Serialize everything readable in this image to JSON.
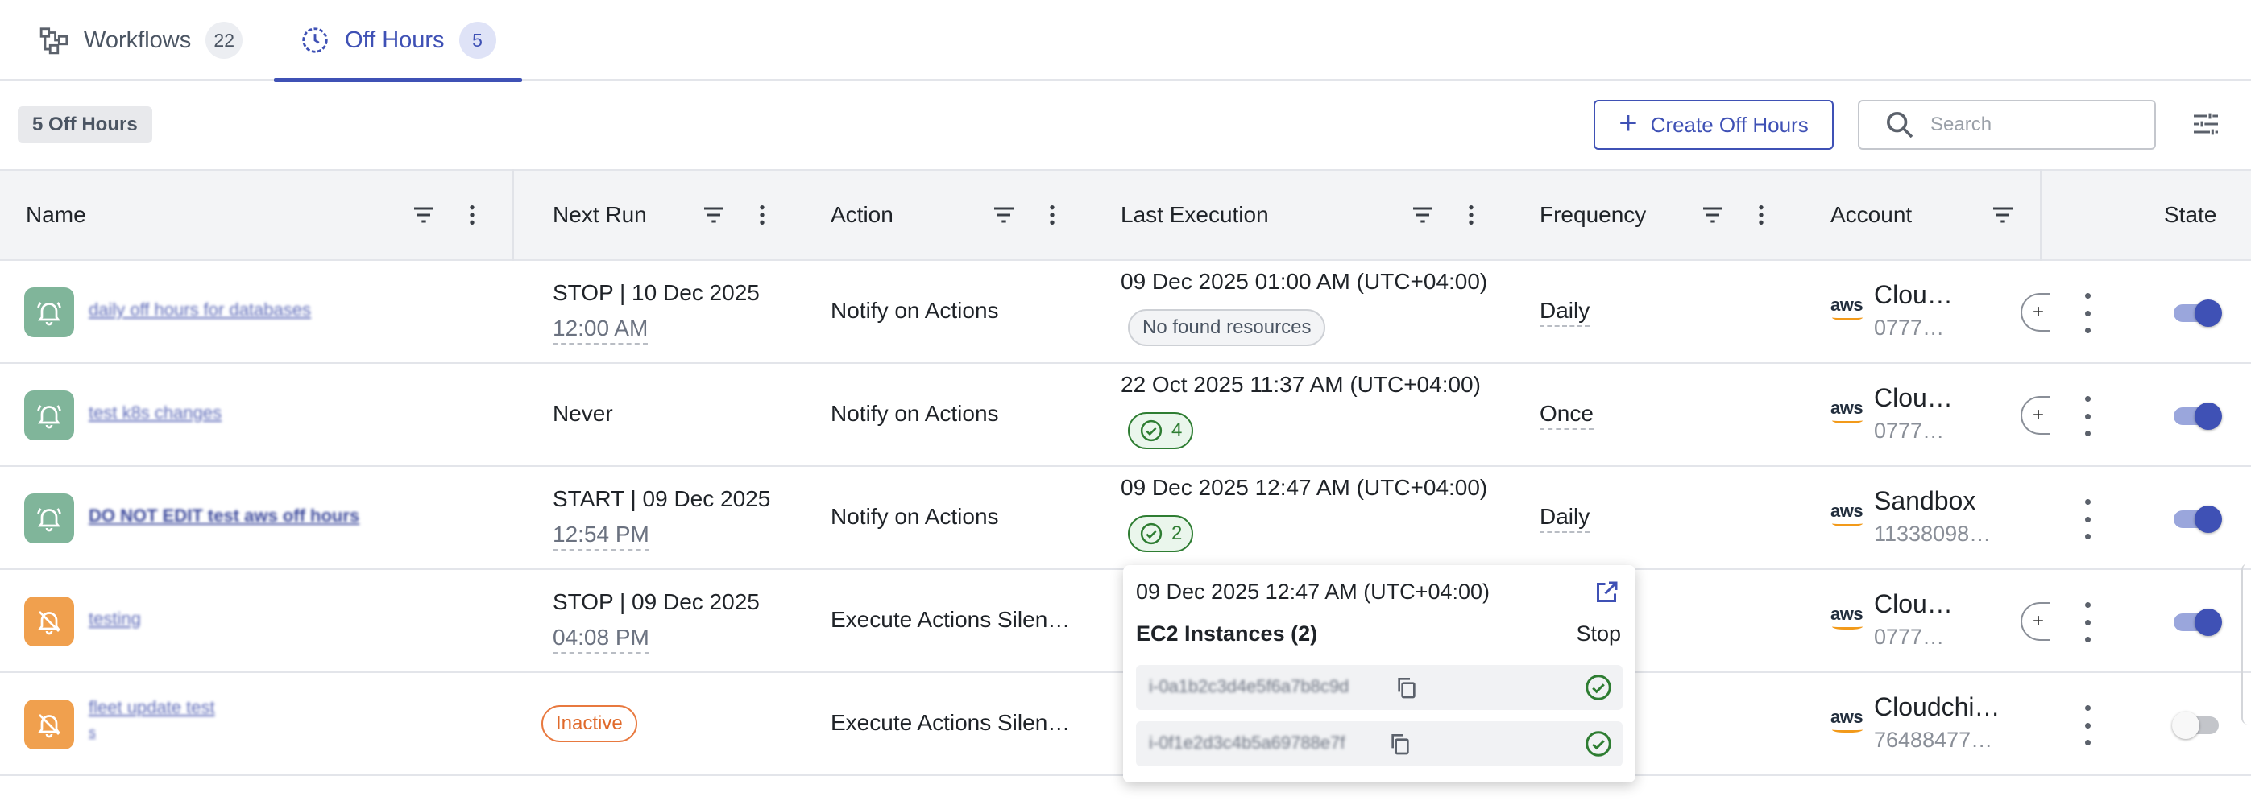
{
  "tabs": [
    {
      "label": "Workflows",
      "count": "22",
      "icon": "workflow-icon",
      "active": false
    },
    {
      "label": "Off Hours",
      "count": "5",
      "icon": "clock-icon",
      "active": true
    }
  ],
  "toolbar": {
    "count_label": "5 Off Hours",
    "create_label": "Create Off Hours",
    "search_placeholder": "Search"
  },
  "columns": {
    "name": "Name",
    "next_run": "Next Run",
    "action": "Action",
    "last_execution": "Last Execution",
    "frequency": "Frequency",
    "account": "Account",
    "state": "State"
  },
  "rows": [
    {
      "name": "daily off hours for databases",
      "name_sub": "",
      "avatar": "bell-icon",
      "next_run": "STOP | 10 Dec 2025",
      "next_run_time": "12:00 AM",
      "action": "Notify on Actions",
      "last_execution": "09 Dec 2025 01:00 AM (UTC+04:00)",
      "last_execution_chip": "No found resources",
      "frequency": "Daily",
      "account_name": "Clou…",
      "account_id": "0777…",
      "state": "on"
    },
    {
      "name": "test k8s changes",
      "name_sub": "",
      "avatar": "bell-icon",
      "next_run": "Never",
      "next_run_time": "",
      "action": "Notify on Actions",
      "last_execution": "22 Oct 2025 11:37 AM (UTC+04:00)",
      "last_execution_chip": "4",
      "frequency": "Once",
      "account_name": "Clou…",
      "account_id": "0777…",
      "state": "on"
    },
    {
      "name": "DO NOT EDIT test aws off hours",
      "name_sub": "",
      "avatar": "bell-icon",
      "next_run": "START | 09 Dec 2025",
      "next_run_time": "12:54 PM",
      "action": "Notify on Actions",
      "last_execution": "09 Dec 2025 12:47 AM (UTC+04:00)",
      "last_execution_chip": "2",
      "frequency": "Daily",
      "account_name": "Sandbox",
      "account_id": "11338098…",
      "state": "on"
    },
    {
      "name": "testing",
      "name_sub": "",
      "avatar": "bell-off-icon",
      "next_run": "STOP | 09 Dec 2025",
      "next_run_time": "04:08 PM",
      "action": "Execute Actions Silen…",
      "last_execution": "",
      "last_execution_chip": "",
      "frequency": "",
      "account_name": "Clou…",
      "account_id": "0777…",
      "state": "on"
    },
    {
      "name": "fleet update test",
      "name_sub": "s",
      "avatar": "bell-off-icon",
      "next_run": "Inactive",
      "next_run_time": "",
      "action": "Execute Actions Silen…",
      "last_execution": "",
      "last_execution_chip": "",
      "frequency": "",
      "account_name": "Cloudchi…",
      "account_id": "76488477…",
      "state": "off"
    }
  ],
  "popover": {
    "title": "09 Dec 2025 12:47 AM (UTC+04:00)",
    "resource_title": "EC2 Instances (2)",
    "resource_action": "Stop",
    "resources": [
      {
        "id": "i-0a1b2c3d4e5f6a7b8c9d"
      },
      {
        "id": "i-0f1e2d3c4b5a69788e7f"
      }
    ]
  },
  "colors": {
    "accent": "#3f51b5",
    "success": "#2e7d32",
    "warning": "#e8793f",
    "avatar_green": "#80b59a",
    "avatar_orange": "#f0a04e"
  }
}
